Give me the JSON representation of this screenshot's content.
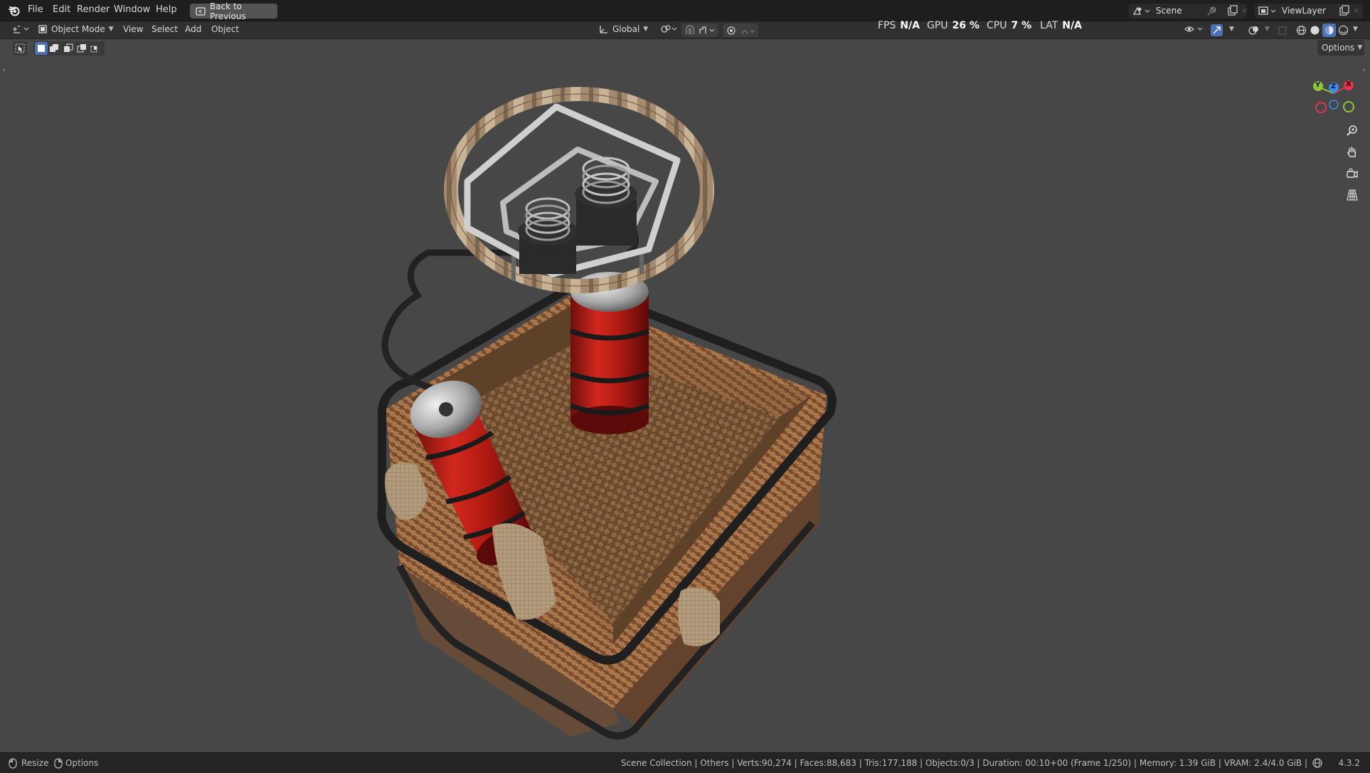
{
  "menu": {
    "items": [
      "File",
      "Edit",
      "Render",
      "Window",
      "Help"
    ],
    "back_label": "Back to Previous"
  },
  "topbar_right": {
    "scene_label": "Scene",
    "viewlayer_label": "ViewLayer"
  },
  "header": {
    "mode_label": "Object Mode",
    "menus": [
      "View",
      "Select",
      "Add",
      "Object"
    ],
    "transform_orientation": "Global",
    "options_label": "Options"
  },
  "perf": {
    "fps_label": "FPS",
    "fps_value": "N/A",
    "gpu_label": "GPU",
    "gpu_value": "26 %",
    "cpu_label": "CPU",
    "cpu_value": "7 %",
    "lat_label": "LAT",
    "lat_value": "N/A"
  },
  "gizmo": {
    "x_label": "X",
    "y_label": "Y",
    "z_label": "Z",
    "colors": {
      "x": "#e0354f",
      "y": "#8bc53f",
      "z": "#3b8be8"
    }
  },
  "statusbar": {
    "resize_label": "Resize",
    "options_label": "Options",
    "stats": "Scene Collection | Others | Verts:90,274 | Faces:88,683 | Tris:177,188 | Objects:0/3 | Duration: 00:10+00 (Frame 1/250) | Memory: 1.39 GiB | VRAM: 2.4/4.0 GiB |",
    "version": "4.3.2"
  },
  "scene": {
    "description_icons": [
      "wicker-basket",
      "red-gas-cylinder",
      "burner-frame",
      "coil-burner"
    ]
  }
}
